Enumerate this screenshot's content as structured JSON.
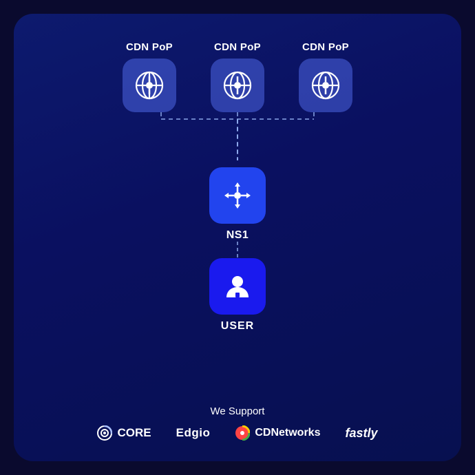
{
  "card": {
    "background": "#0d1a6e"
  },
  "cdn_nodes": [
    {
      "label": "CDN PoP"
    },
    {
      "label": "CDN PoP"
    },
    {
      "label": "CDN PoP"
    }
  ],
  "ns1": {
    "label": "NS1"
  },
  "user": {
    "label": "USER"
  },
  "support": {
    "heading": "We Support",
    "logos": [
      {
        "name": "CORE",
        "icon": "core-icon"
      },
      {
        "name": "Edgio",
        "icon": "edgio-icon"
      },
      {
        "name": "CDNetworks",
        "icon": "cdnetworks-icon"
      },
      {
        "name": "fastly",
        "icon": "fastly-icon"
      }
    ]
  }
}
